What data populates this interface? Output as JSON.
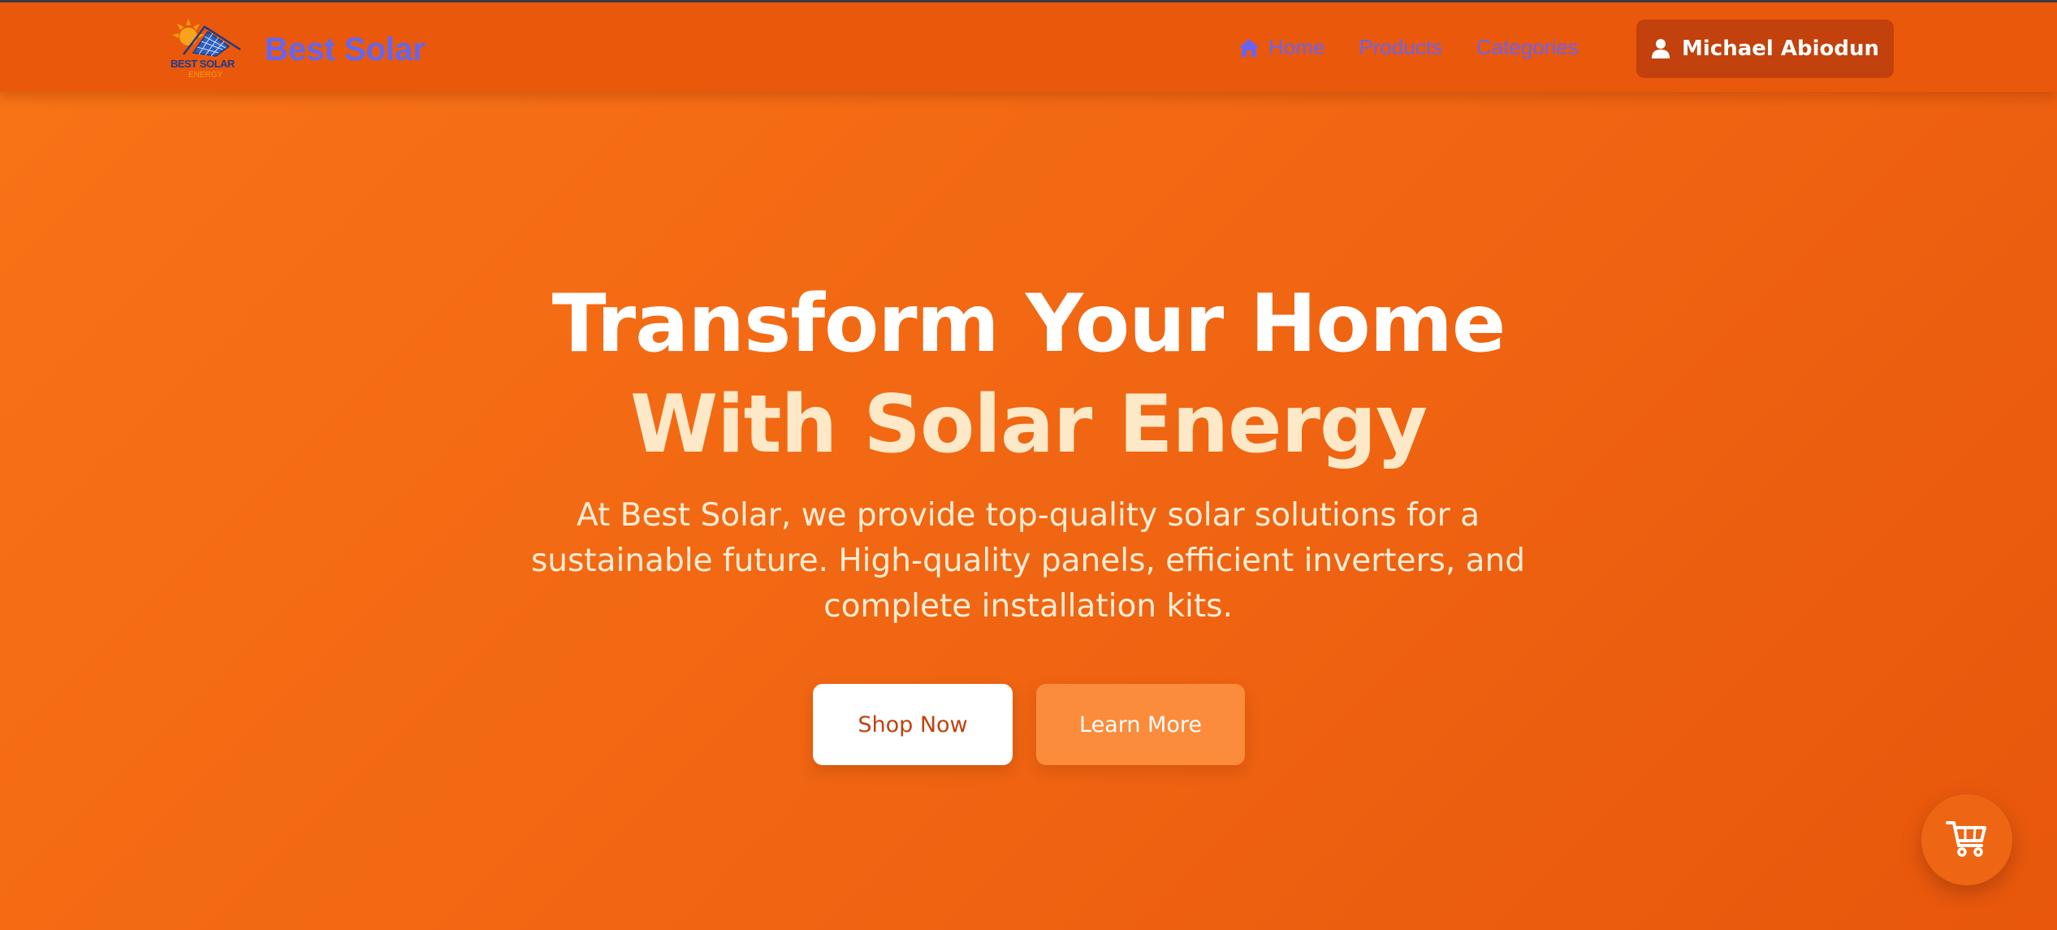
{
  "colors": {
    "navbar_bg": "#ea580c",
    "hero_gradient_start": "#f97316",
    "hero_gradient_end": "#e8570c",
    "nav_link": "#6366f1",
    "user_button_bg": "#c2410c",
    "headline_primary": "#ffffff",
    "headline_accent": "#fde9c8",
    "shop_button_bg": "#ffffff",
    "learn_button_bg": "#fb8c3c"
  },
  "header": {
    "logo": {
      "icon": "solar-panel-sun-logo",
      "text_main": "BEST SOLAR",
      "text_sub": "ENERGY"
    },
    "brand_name": "Best Solar",
    "nav": [
      {
        "label": "Home",
        "icon": "home-icon"
      },
      {
        "label": "Products"
      },
      {
        "label": "Categories"
      }
    ],
    "user": {
      "name": "Michael Abiodun",
      "icon": "user-icon"
    }
  },
  "hero": {
    "headline_line1": "Transform Your Home",
    "headline_line2": "With Solar Energy",
    "description": "At Best Solar, we provide top-quality solar solutions for a sustainable future. High-quality panels, efficient inverters, and complete installation kits.",
    "primary_cta": "Shop Now",
    "secondary_cta": "Learn More"
  },
  "cart": {
    "icon": "cart-icon"
  }
}
